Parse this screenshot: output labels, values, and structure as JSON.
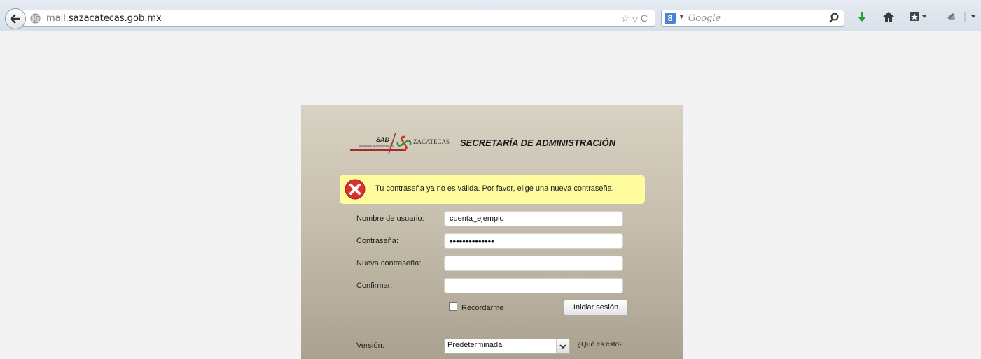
{
  "browser": {
    "url_prefix": "mail.",
    "url_domain": "sazacatecas.gob.mx",
    "search_placeholder": "Google",
    "search_engine_letter": "8"
  },
  "logo": {
    "sad": "SAD",
    "sad_sub": "SECRETARÍA DE ADMINISTRACIÓN",
    "state": "ZACATECAS",
    "title": "SECRETARÍA DE ADMINISTRACIÓN"
  },
  "alert": {
    "message": "Tu contraseña ya no es válida. Por favor, elige una nueva contraseña."
  },
  "form": {
    "username_label": "Nombre de usuario:",
    "username_value": "cuenta_ejemplo",
    "password_label": "Contraseña:",
    "password_value": "••••••••••••••",
    "new_password_label": "Nueva contraseña:",
    "new_password_value": "",
    "confirm_label": "Confirmar:",
    "confirm_value": "",
    "remember_label": "Recordarme",
    "login_button": "Iniciar sesión",
    "version_label": "Versión:",
    "version_value": "Predeterminada",
    "whatis_link": "¿Qué es esto?"
  },
  "colors": {
    "alert_bg": "#fefc9e",
    "error_icon": "#d9302f",
    "download_icon": "#2e9a3c"
  }
}
